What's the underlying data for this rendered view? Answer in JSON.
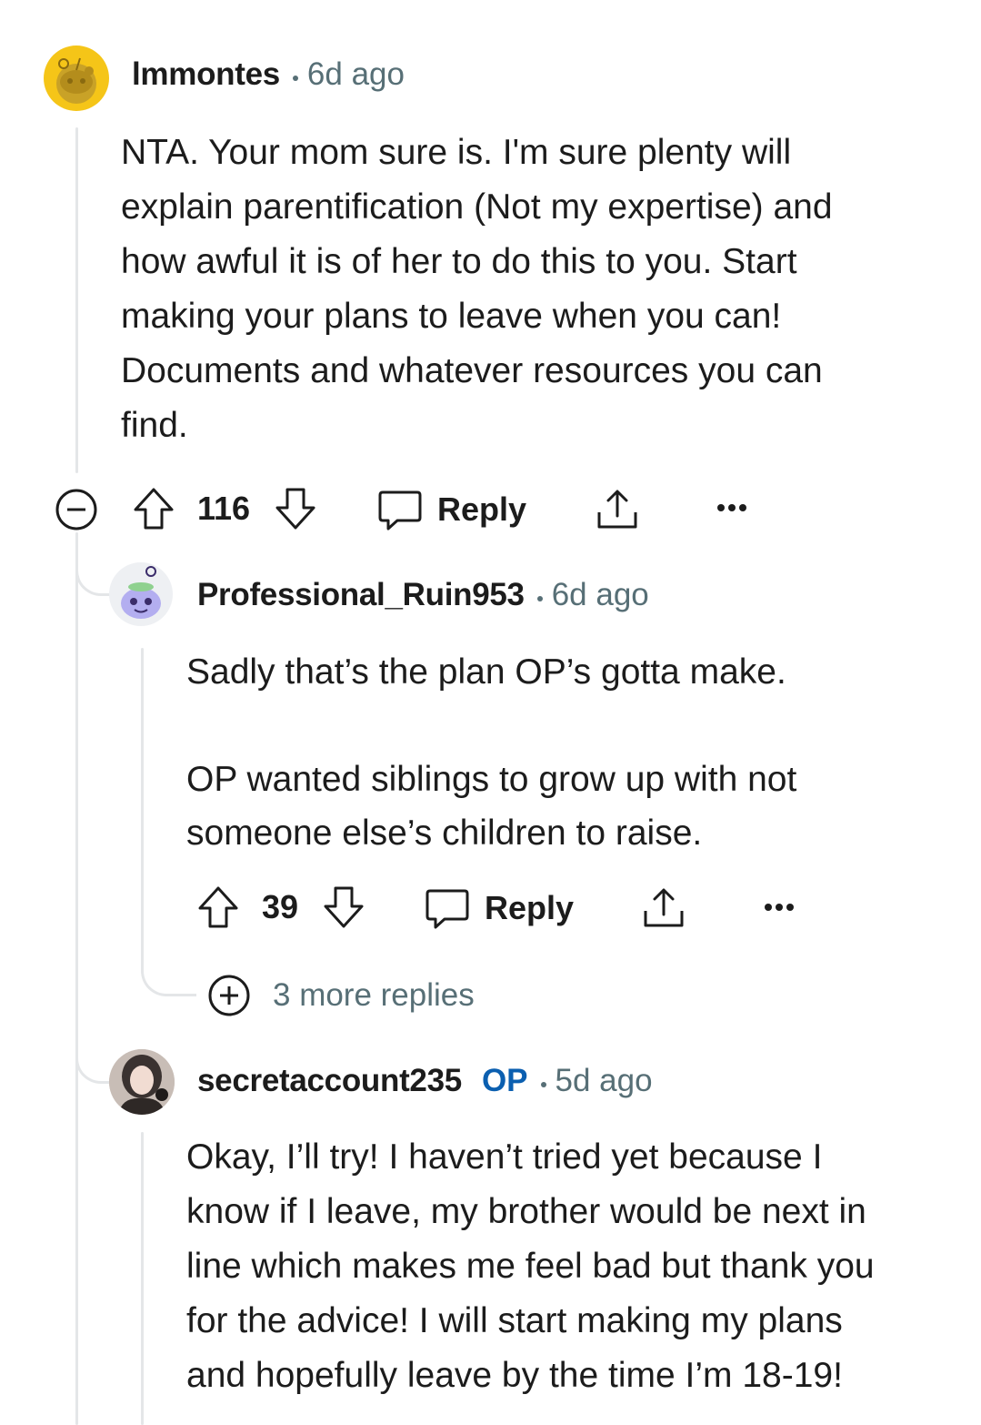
{
  "comments": [
    {
      "author": "lmmontes",
      "time": "6d ago",
      "body": "NTA. Your mom sure is. I'm sure plenty will\nexplain parentification (Not my expertise) and\nhow awful it is of her to do this to you. Start\nmaking your plans to leave when you can!\nDocuments and whatever resources you can\nfind.",
      "votes": "116",
      "reply_label": "Reply"
    },
    {
      "author": "Professional_Ruin953",
      "time": "6d ago",
      "body": "Sadly that’s the plan OP’s gotta make.\n\nOP wanted siblings to grow up with not\nsomeone else’s children to raise.",
      "votes": "39",
      "reply_label": "Reply",
      "more_replies": "3 more replies"
    },
    {
      "author": "secretaccount235",
      "op_badge": "OP",
      "time": "5d ago",
      "body": "Okay, I’ll try! I haven’t tried yet because I\nknow if I leave, my brother would be next in\nline which makes me feel bad but thank you\nfor the advice! I will start making my plans\nand hopefully leave by the time I’m 18-19!"
    }
  ],
  "colors": {
    "accent_op": "#0b5fb0",
    "meta": "#576f76",
    "thread_line": "#e4e6e8"
  }
}
